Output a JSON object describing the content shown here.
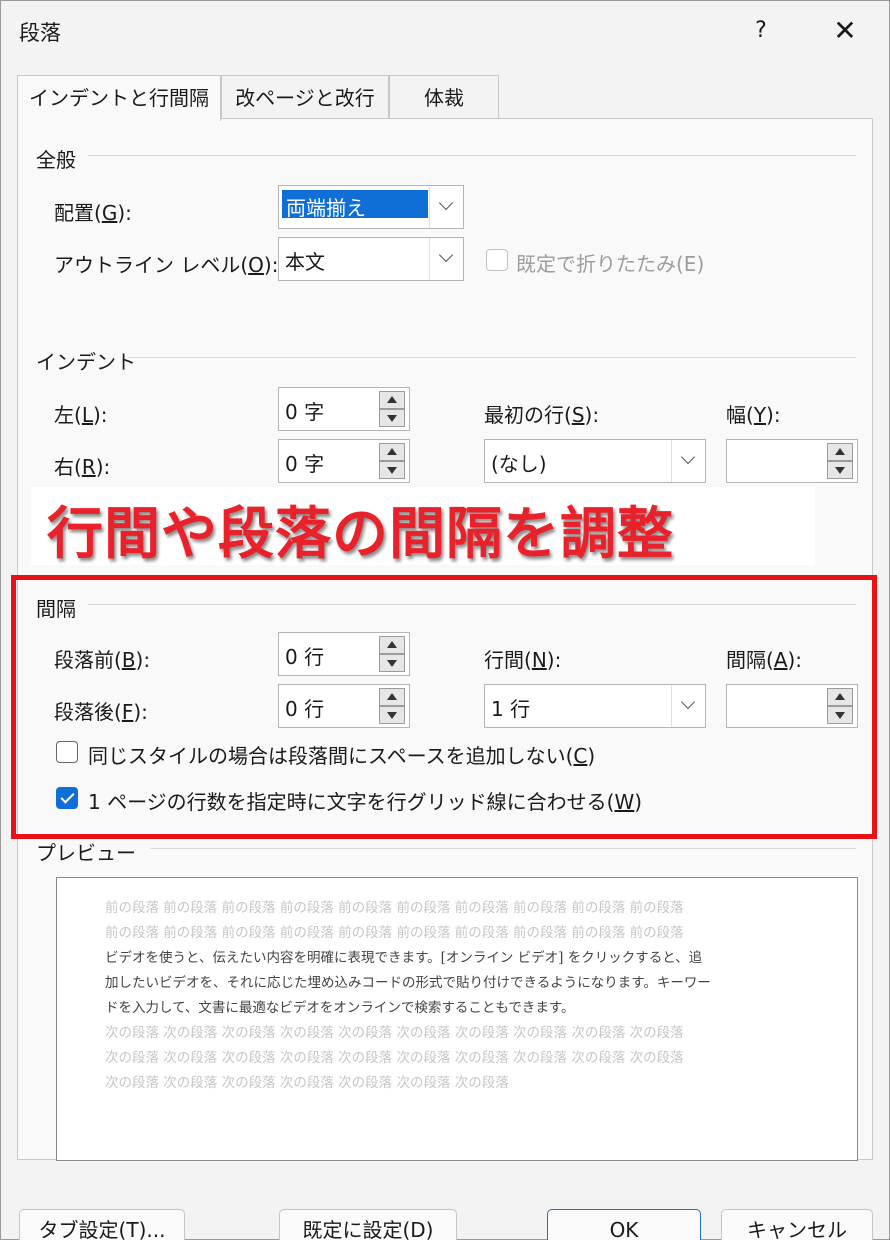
{
  "window": {
    "title": "段落",
    "help_label": "?",
    "close_label": "✕"
  },
  "tabs": [
    {
      "label": "インデントと行間隔",
      "active": true
    },
    {
      "label": "改ページと改行",
      "active": false
    },
    {
      "label": "体裁",
      "active": false
    }
  ],
  "general": {
    "title": "全般",
    "alignment": {
      "label": "配置(",
      "key": "G",
      "suffix": "):",
      "value": "両端揃え"
    },
    "outline": {
      "label": "アウトライン レベル(",
      "key": "O",
      "suffix": "):",
      "value": "本文"
    },
    "collapse": {
      "label": "既定で折りたたみ(E)",
      "checked": false,
      "enabled": false
    }
  },
  "indent": {
    "title": "インデント",
    "left": {
      "label": "左(",
      "key": "L",
      "suffix": "):",
      "value": "0 字"
    },
    "right": {
      "label": "右(",
      "key": "R",
      "suffix": "):",
      "value": "0 字"
    },
    "first_line": {
      "label": "最初の行(",
      "key": "S",
      "suffix": "):",
      "value": "(なし)"
    },
    "width": {
      "label": "幅(",
      "key": "Y",
      "suffix": "):",
      "value": ""
    }
  },
  "annotation": {
    "text": "行間や段落の間隔を調整",
    "color": "#e8212a"
  },
  "spacing": {
    "title": "間隔",
    "before": {
      "label": "段落前(",
      "key": "B",
      "suffix": "):",
      "value": "0 行"
    },
    "after": {
      "label": "段落後(",
      "key": "F",
      "suffix": "):",
      "value": "0 行"
    },
    "line_spacing": {
      "label": "行間(",
      "key": "N",
      "suffix": "):",
      "value": "1 行"
    },
    "at": {
      "label": "間隔(",
      "key": "A",
      "suffix": "):",
      "value": ""
    },
    "dont_add_space": {
      "label": "同じスタイルの場合は段落間にスペースを追加しない(",
      "key": "C",
      "suffix": ")",
      "checked": false
    },
    "snap_to_grid": {
      "label": "1 ページの行数を指定時に文字を行グリッド線に合わせる(",
      "key": "W",
      "suffix": ")",
      "checked": true
    }
  },
  "preview": {
    "title": "プレビュー",
    "lines": [
      {
        "text": "前の段落 前の段落 前の段落 前の段落 前の段落 前の段落 前の段落 前の段落 前の段落 前の段落",
        "tone": "grey"
      },
      {
        "text": "前の段落 前の段落 前の段落 前の段落 前の段落 前の段落 前の段落 前の段落 前の段落 前の段落",
        "tone": "grey"
      },
      {
        "text": "ビデオを使うと、伝えたい内容を明確に表現できます。[オンライン ビデオ] をクリックすると、追",
        "tone": "dark"
      },
      {
        "text": "加したいビデオを、それに応じた埋め込みコードの形式で貼り付けできるようになります。キーワー",
        "tone": "dark"
      },
      {
        "text": "ドを入力して、文書に最適なビデオをオンラインで検索することもできます。",
        "tone": "dark"
      },
      {
        "text": "次の段落 次の段落 次の段落 次の段落 次の段落 次の段落 次の段落 次の段落 次の段落 次の段落",
        "tone": "grey"
      },
      {
        "text": "次の段落 次の段落 次の段落 次の段落 次の段落 次の段落 次の段落 次の段落 次の段落 次の段落",
        "tone": "grey"
      },
      {
        "text": "次の段落 次の段落 次の段落 次の段落 次の段落 次の段落 次の段落",
        "tone": "grey"
      }
    ]
  },
  "buttons": {
    "tabs": "タブ設定(T)...",
    "set_default": "既定に設定(D)",
    "ok": "OK",
    "cancel": "キャンセル"
  }
}
